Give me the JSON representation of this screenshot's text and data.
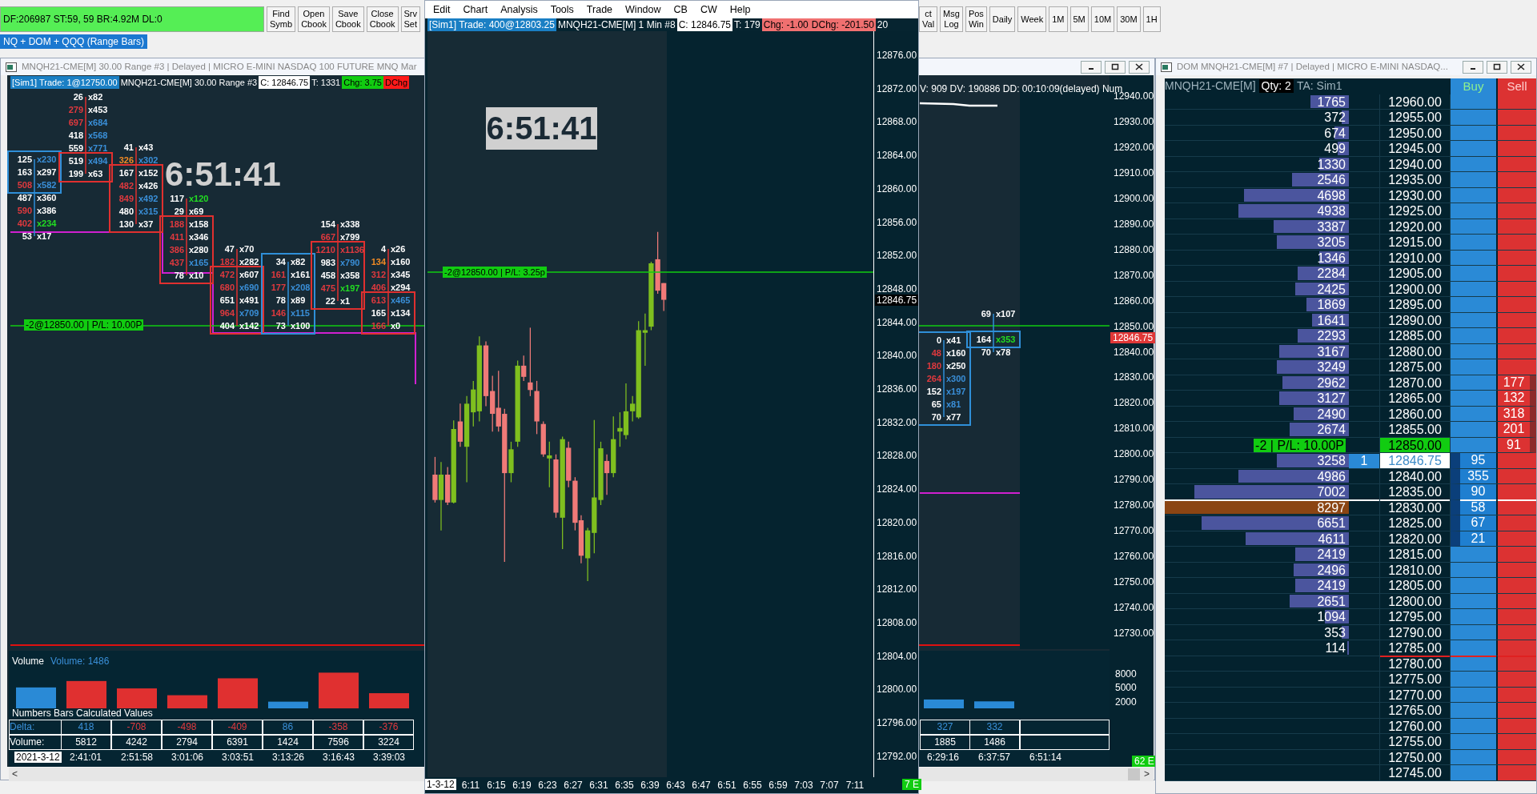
{
  "status_field": "DF:206987 ST:59, 59 BR:4.92M DL:0",
  "toolbar_left": [
    {
      "lines": [
        "Find",
        "Symb"
      ]
    },
    {
      "lines": [
        "Open",
        "Cbook"
      ]
    },
    {
      "lines": [
        "Save",
        "Cbook"
      ]
    },
    {
      "lines": [
        "Close",
        "Cbook"
      ]
    },
    {
      "lines": [
        "Srv",
        "Set"
      ]
    }
  ],
  "toolbar_right": [
    {
      "lines": [
        "ct",
        "Val"
      ]
    },
    {
      "lines": [
        "Msg",
        "Log"
      ]
    },
    {
      "lines": [
        "Pos",
        "Win"
      ]
    },
    {
      "lines": [
        "Daily"
      ]
    },
    {
      "lines": [
        "Week"
      ]
    },
    {
      "lines": [
        "1M"
      ]
    },
    {
      "lines": [
        "5M"
      ]
    },
    {
      "lines": [
        "10M"
      ]
    },
    {
      "lines": [
        "30M"
      ]
    },
    {
      "lines": [
        "1H"
      ]
    }
  ],
  "chartbook_tab": "NQ + DOM + QQQ (Range Bars)",
  "range_chart": {
    "title": "MNQH21-CME[M] 30.00 Range #3 | Delayed | MICRO E-MINI NASDAQ 100 FUTURE MNQ Mar",
    "header": [
      {
        "text": "[Sim1] Trade: 1@12750.00",
        "kind": "account"
      },
      {
        "text": "MNQH21-CME[M] 30.00 Range #3",
        "kind": "plain"
      },
      {
        "text": "C: 12846.75",
        "kind": "close"
      },
      {
        "text": "T: 1331",
        "kind": "plain"
      },
      {
        "text": "Chg: 3.75",
        "kind": "up"
      },
      {
        "text": "DChg",
        "kind": "loss"
      }
    ],
    "header_right": "V: 909 DV: 190886 DD: 00:10:09(delayed) Num",
    "clock": "6:51:41",
    "position_label": "-2@12850.00 | P/L: 10.00P",
    "footprint_bars": [
      {
        "color": "#2f8fd8",
        "box": [
          {
            "bid": {
              "text": "125",
              "color": "#ffffff"
            },
            "ask": {
              "text": "x230",
              "color": "#3a8fd8"
            }
          },
          {
            "bid": {
              "text": "163",
              "color": "#ffffff"
            },
            "ask": {
              "text": "x297",
              "color": "#ffffff"
            }
          },
          {
            "bid": {
              "text": "508",
              "color": "#e0393e"
            },
            "ask": {
              "text": "x582",
              "color": "#3a8fd8"
            }
          }
        ],
        "below": [
          {
            "bid": {
              "text": "487",
              "color": "#ffffff"
            },
            "ask": {
              "text": "x360",
              "color": "#ffffff"
            }
          },
          {
            "bid": {
              "text": "590",
              "color": "#e0393e"
            },
            "ask": {
              "text": "x386",
              "color": "#ffffff"
            }
          },
          {
            "bid": {
              "text": "402",
              "color": "#e0393e"
            },
            "ask": {
              "text": "x234",
              "color": "#22dd22"
            }
          },
          {
            "bid": {
              "text": "53",
              "color": "#ffffff"
            },
            "ask": {
              "text": "x17",
              "color": "#ffffff"
            }
          }
        ]
      },
      {
        "color": "#e0302f",
        "above": [
          {
            "bid": {
              "text": "26",
              "color": "#ffffff"
            },
            "ask": {
              "text": "x82",
              "color": "#ffffff"
            }
          },
          {
            "bid": {
              "text": "279",
              "color": "#e0393e"
            },
            "ask": {
              "text": "x453",
              "color": "#ffffff"
            }
          },
          {
            "bid": {
              "text": "697",
              "color": "#e0393e"
            },
            "ask": {
              "text": "x684",
              "color": "#3a8fd8"
            }
          },
          {
            "bid": {
              "text": "418",
              "color": "#ffffff"
            },
            "ask": {
              "text": "x568",
              "color": "#3a8fd8"
            }
          },
          {
            "bid": {
              "text": "559",
              "color": "#ffffff"
            },
            "ask": {
              "text": "x771",
              "color": "#3a8fd8"
            }
          }
        ],
        "box": [
          {
            "bid": {
              "text": "519",
              "color": "#ffffff"
            },
            "ask": {
              "text": "x494",
              "color": "#3a8fd8"
            }
          },
          {
            "bid": {
              "text": "199",
              "color": "#ffffff"
            },
            "ask": {
              "text": "x63",
              "color": "#ffffff"
            }
          }
        ]
      },
      {
        "color": "#e0302f",
        "above": [
          {
            "bid": {
              "text": "41",
              "color": "#ffffff"
            },
            "ask": {
              "text": "x43",
              "color": "#ffffff"
            }
          },
          {
            "bid": {
              "text": "326",
              "color": "#f08a24"
            },
            "ask": {
              "text": "x302",
              "color": "#3a8fd8"
            }
          }
        ],
        "box": [
          {
            "bid": {
              "text": "167",
              "color": "#ffffff"
            },
            "ask": {
              "text": "x152",
              "color": "#ffffff"
            }
          },
          {
            "bid": {
              "text": "482",
              "color": "#e0393e"
            },
            "ask": {
              "text": "x426",
              "color": "#ffffff"
            }
          },
          {
            "bid": {
              "text": "849",
              "color": "#e0393e"
            },
            "ask": {
              "text": "x492",
              "color": "#3a8fd8"
            }
          },
          {
            "bid": {
              "text": "480",
              "color": "#ffffff"
            },
            "ask": {
              "text": "x315",
              "color": "#3a8fd8"
            }
          },
          {
            "bid": {
              "text": "130",
              "color": "#ffffff"
            },
            "ask": {
              "text": "x37",
              "color": "#ffffff"
            }
          }
        ]
      },
      {
        "color": "#e0302f",
        "above": [
          {
            "bid": {
              "text": "117",
              "color": "#ffffff"
            },
            "ask": {
              "text": "x120",
              "color": "#22dd22"
            }
          },
          {
            "bid": {
              "text": "29",
              "color": "#ffffff"
            },
            "ask": {
              "text": "x69",
              "color": "#ffffff"
            }
          }
        ],
        "box": [
          {
            "bid": {
              "text": "188",
              "color": "#e0393e"
            },
            "ask": {
              "text": "x158",
              "color": "#ffffff"
            }
          },
          {
            "bid": {
              "text": "411",
              "color": "#e0393e"
            },
            "ask": {
              "text": "x346",
              "color": "#ffffff"
            }
          },
          {
            "bid": {
              "text": "386",
              "color": "#e0393e"
            },
            "ask": {
              "text": "x280",
              "color": "#ffffff"
            }
          },
          {
            "bid": {
              "text": "437",
              "color": "#e0393e"
            },
            "ask": {
              "text": "x165",
              "color": "#3a8fd8"
            }
          },
          {
            "bid": {
              "text": "78",
              "color": "#ffffff"
            },
            "ask": {
              "text": "x10",
              "color": "#ffffff"
            }
          }
        ]
      },
      {
        "color": "#e0302f",
        "above": [
          {
            "bid": {
              "text": "47",
              "color": "#ffffff"
            },
            "ask": {
              "text": "x70",
              "color": "#ffffff"
            }
          },
          {
            "bid": {
              "text": "182",
              "color": "#e0393e"
            },
            "ask": {
              "text": "x282",
              "color": "#ffffff"
            }
          }
        ],
        "box": [
          {
            "bid": {
              "text": "472",
              "color": "#e0393e"
            },
            "ask": {
              "text": "x607",
              "color": "#ffffff"
            }
          },
          {
            "bid": {
              "text": "680",
              "color": "#e0393e"
            },
            "ask": {
              "text": "x690",
              "color": "#3a8fd8"
            }
          },
          {
            "bid": {
              "text": "651",
              "color": "#ffffff"
            },
            "ask": {
              "text": "x491",
              "color": "#ffffff"
            }
          },
          {
            "bid": {
              "text": "964",
              "color": "#e0393e"
            },
            "ask": {
              "text": "x709",
              "color": "#3a8fd8"
            }
          },
          {
            "bid": {
              "text": "404",
              "color": "#ffffff"
            },
            "ask": {
              "text": "x142",
              "color": "#ffffff"
            }
          }
        ]
      },
      {
        "color": "#2f8fd8",
        "box": [
          {
            "bid": {
              "text": "34",
              "color": "#ffffff"
            },
            "ask": {
              "text": "x82",
              "color": "#ffffff"
            }
          },
          {
            "bid": {
              "text": "161",
              "color": "#e0393e"
            },
            "ask": {
              "text": "x161",
              "color": "#ffffff"
            }
          },
          {
            "bid": {
              "text": "177",
              "color": "#e0393e"
            },
            "ask": {
              "text": "x208",
              "color": "#3a8fd8"
            }
          },
          {
            "bid": {
              "text": "78",
              "color": "#ffffff"
            },
            "ask": {
              "text": "x89",
              "color": "#ffffff"
            }
          },
          {
            "bid": {
              "text": "146",
              "color": "#e0393e"
            },
            "ask": {
              "text": "x115",
              "color": "#3a8fd8"
            }
          },
          {
            "bid": {
              "text": "73",
              "color": "#ffffff"
            },
            "ask": {
              "text": "x100",
              "color": "#ffffff"
            }
          }
        ]
      },
      {
        "color": "#e0302f",
        "above": [
          {
            "bid": {
              "text": "154",
              "color": "#ffffff"
            },
            "ask": {
              "text": "x338",
              "color": "#ffffff"
            }
          },
          {
            "bid": {
              "text": "667",
              "color": "#e0393e"
            },
            "ask": {
              "text": "x799",
              "color": "#ffffff"
            }
          }
        ],
        "box": [
          {
            "bid": {
              "text": "1210",
              "color": "#e0393e"
            },
            "ask": {
              "text": "x1136",
              "color": "#e0393e"
            }
          },
          {
            "bid": {
              "text": "983",
              "color": "#ffffff"
            },
            "ask": {
              "text": "x790",
              "color": "#3a8fd8"
            }
          },
          {
            "bid": {
              "text": "458",
              "color": "#ffffff"
            },
            "ask": {
              "text": "x358",
              "color": "#ffffff"
            }
          },
          {
            "bid": {
              "text": "475",
              "color": "#e0393e"
            },
            "ask": {
              "text": "x197",
              "color": "#22dd22"
            }
          },
          {
            "bid": {
              "text": "22",
              "color": "#ffffff"
            },
            "ask": {
              "text": "x1",
              "color": "#ffffff"
            }
          }
        ]
      },
      {
        "color": "#e0302f",
        "above": [
          {
            "bid": {
              "text": "4",
              "color": "#ffffff"
            },
            "ask": {
              "text": "x26",
              "color": "#ffffff"
            }
          },
          {
            "bid": {
              "text": "134",
              "color": "#f08a24"
            },
            "ask": {
              "text": "x160",
              "color": "#ffffff"
            }
          },
          {
            "bid": {
              "text": "312",
              "color": "#e0393e"
            },
            "ask": {
              "text": "x345",
              "color": "#ffffff"
            }
          },
          {
            "bid": {
              "text": "406",
              "color": "#e0393e"
            },
            "ask": {
              "text": "x294",
              "color": "#ffffff"
            }
          }
        ],
        "box": [
          {
            "bid": {
              "text": "613",
              "color": "#e0393e"
            },
            "ask": {
              "text": "x465",
              "color": "#3a8fd8"
            }
          },
          {
            "bid": {
              "text": "165",
              "color": "#ffffff"
            },
            "ask": {
              "text": "x134",
              "color": "#ffffff"
            }
          },
          {
            "bid": {
              "text": "166",
              "color": "#e0393e"
            },
            "ask": {
              "text": "x0",
              "color": "#ffffff"
            }
          }
        ]
      },
      {
        "color": "#2f8fd8",
        "box": [
          {
            "bid": {
              "text": "0",
              "color": "#ffffff"
            },
            "ask": {
              "text": "x41",
              "color": "#ffffff"
            }
          },
          {
            "bid": {
              "text": "48",
              "color": "#e0393e"
            },
            "ask": {
              "text": "x160",
              "color": "#ffffff"
            }
          },
          {
            "bid": {
              "text": "180",
              "color": "#e0393e"
            },
            "ask": {
              "text": "x250",
              "color": "#ffffff"
            }
          },
          {
            "bid": {
              "text": "264",
              "color": "#e0393e"
            },
            "ask": {
              "text": "x300",
              "color": "#3a8fd8"
            }
          },
          {
            "bid": {
              "text": "152",
              "color": "#ffffff"
            },
            "ask": {
              "text": "x197",
              "color": "#3a8fd8"
            }
          },
          {
            "bid": {
              "text": "65",
              "color": "#ffffff"
            },
            "ask": {
              "text": "x81",
              "color": "#3a8fd8"
            }
          },
          {
            "bid": {
              "text": "70",
              "color": "#ffffff"
            },
            "ask": {
              "text": "x77",
              "color": "#ffffff"
            }
          }
        ]
      },
      {
        "color": "#2f8fd8",
        "above": [
          {
            "bid": {
              "text": "69",
              "color": "#ffffff"
            },
            "ask": {
              "text": "x107",
              "color": "#ffffff"
            }
          }
        ],
        "box": [
          {
            "bid": {
              "text": "164",
              "color": "#ffffff"
            },
            "ask": {
              "text": "x353",
              "color": "#22dd22"
            }
          }
        ],
        "below": [
          {
            "bid": {
              "text": "70",
              "color": "#ffffff"
            },
            "ask": {
              "text": "x78",
              "color": "#ffffff"
            }
          }
        ]
      }
    ],
    "price_axis": [
      "12940.00",
      "12930.00",
      "12920.00",
      "12910.00",
      "12900.00",
      "12890.00",
      "12880.00",
      "12870.00",
      "12860.00",
      "12850.00",
      "12840.00",
      "12830.00",
      "12820.00",
      "12810.00",
      "12800.00",
      "12790.00",
      "12780.00",
      "12770.00",
      "12760.00",
      "12750.00",
      "12740.00",
      "12730.00"
    ],
    "last_price": "12846.75",
    "volume_title": "Volume",
    "volume_reading": "Volume: 1486",
    "volume_axis": [
      "8000",
      "5000",
      "2000"
    ],
    "study_title": "Numbers Bars Calculated Values",
    "table": [
      {
        "label": {
          "text": "Delta:",
          "color": "#3a8fd8"
        },
        "cells": [
          {
            "text": "418",
            "color": "#3a8fd8"
          },
          {
            "text": "-708",
            "color": "#e0393e"
          },
          {
            "text": "-498",
            "color": "#e0393e"
          },
          {
            "text": "-409",
            "color": "#e0393e"
          },
          {
            "text": "86",
            "color": "#3a8fd8"
          },
          {
            "text": "-358",
            "color": "#e0393e"
          },
          {
            "text": "-376",
            "color": "#e0393e"
          },
          {
            "text": "327",
            "color": "#3a8fd8"
          },
          {
            "text": "332",
            "color": "#3a8fd8"
          }
        ]
      },
      {
        "label": {
          "text": "Volume:",
          "color": "#ffffff"
        },
        "cells": [
          "5812",
          "4242",
          "2794",
          "6391",
          "1424",
          "7596",
          "3224",
          "1885",
          "1486"
        ]
      }
    ],
    "date": "2021-3-12",
    "time_axis": [
      "2:41:01",
      "2:51:58",
      "3:01:06",
      "3:03:51",
      "3:13:26",
      "3:16:43",
      "3:39:03",
      "6:29:16",
      "6:37:57",
      "6:51:14"
    ],
    "status_badge": "62 E",
    "scroll_left": "<",
    "scroll_right": ">"
  },
  "minute_chart": {
    "menu": [
      "Edit",
      "Chart",
      "Analysis",
      "Tools",
      "Trade",
      "Window",
      "CB",
      "CW",
      "Help"
    ],
    "header": [
      {
        "text": "[Sim1] Trade: 400@12803.25",
        "kind": "account"
      },
      {
        "text": "MNQH21-CME[M] 1 Min #8",
        "kind": "plain"
      },
      {
        "text": "C: 12846.75",
        "kind": "close"
      },
      {
        "text": "T: 179",
        "kind": "plain"
      },
      {
        "text": "Chg: -1.00",
        "kind": "down"
      },
      {
        "text": "DChg: -201.50",
        "kind": "down"
      },
      {
        "text": "20",
        "kind": "plain"
      }
    ],
    "clock": "6:51:41",
    "position_label": "-2@12850.00 | P/L: 3.25p",
    "price_axis": [
      "12876.00",
      "12872.00",
      "12868.00",
      "12864.00",
      "12860.00",
      "12856.00",
      "12852.00",
      "12848.00",
      "12844.00",
      "12840.00",
      "12836.00",
      "12832.00",
      "12828.00",
      "12824.00",
      "12820.00",
      "12816.00",
      "12812.00",
      "12808.00",
      "12804.00",
      "12800.00",
      "12796.00",
      "12792.00"
    ],
    "last_price": "12846.75",
    "date": "1-3-12",
    "time_axis": [
      "6:11",
      "6:15",
      "6:19",
      "6:23",
      "6:27",
      "6:31",
      "6:35",
      "6:39",
      "6:43",
      "6:47",
      "6:51",
      "6:55",
      "6:59",
      "7:03",
      "7:07",
      "7:11"
    ],
    "status_badge": "7 E"
  },
  "dom": {
    "title": "DOM MNQH21-CME[M] #7 | Delayed | MICRO E-MINI NASDAQ...",
    "symbol": "MNQH21-CME[M]",
    "quantity": "Qty: 2",
    "account": "TA: Sim1",
    "buy_header": "Buy",
    "sell_header": "Sell",
    "rows": [
      {
        "price": "12960.00",
        "kind": "normal",
        "volume": "1765",
        "level": 0.21
      },
      {
        "price": "12955.00",
        "kind": "normal",
        "volume": "372",
        "level": 0.04
      },
      {
        "price": "12950.00",
        "kind": "normal",
        "volume": "674",
        "level": 0.08
      },
      {
        "price": "12945.00",
        "kind": "normal",
        "volume": "499",
        "level": 0.06
      },
      {
        "price": "12940.00",
        "kind": "normal",
        "volume": "1330",
        "level": 0.16
      },
      {
        "price": "12935.00",
        "kind": "normal",
        "volume": "2546",
        "level": 0.31
      },
      {
        "price": "12930.00",
        "kind": "normal",
        "volume": "4698",
        "level": 0.57
      },
      {
        "price": "12925.00",
        "kind": "normal",
        "volume": "4938",
        "level": 0.6
      },
      {
        "price": "12920.00",
        "kind": "normal",
        "volume": "3387",
        "level": 0.41
      },
      {
        "price": "12915.00",
        "kind": "normal",
        "volume": "3205",
        "level": 0.39
      },
      {
        "price": "12910.00",
        "kind": "normal",
        "volume": "1346",
        "level": 0.16
      },
      {
        "price": "12905.00",
        "kind": "normal",
        "volume": "2284",
        "level": 0.28
      },
      {
        "price": "12900.00",
        "kind": "normal",
        "volume": "2425",
        "level": 0.29
      },
      {
        "price": "12895.00",
        "kind": "normal",
        "volume": "1869",
        "level": 0.23
      },
      {
        "price": "12890.00",
        "kind": "normal",
        "volume": "1641",
        "level": 0.2
      },
      {
        "price": "12885.00",
        "kind": "normal",
        "volume": "2293",
        "level": 0.28
      },
      {
        "price": "12880.00",
        "kind": "normal",
        "volume": "3167",
        "level": 0.38
      },
      {
        "price": "12875.00",
        "kind": "normal",
        "volume": "3249",
        "level": 0.39
      },
      {
        "price": "12870.00",
        "kind": "normal",
        "volume": "2962",
        "level": 0.36,
        "sell": "177"
      },
      {
        "price": "12865.00",
        "kind": "normal",
        "volume": "3127",
        "level": 0.38,
        "sell": "132"
      },
      {
        "price": "12860.00",
        "kind": "normal",
        "volume": "2490",
        "level": 0.3,
        "sell": "318"
      },
      {
        "price": "12855.00",
        "kind": "normal",
        "volume": "2674",
        "level": 0.32,
        "sell": "201"
      },
      {
        "price": "12850.00",
        "kind": "position",
        "position_label": "-2 | P/L: 10.00P",
        "sell": "91"
      },
      {
        "price": "12846.75",
        "kind": "last",
        "volume": "3258",
        "level": 0.39,
        "bid": "1",
        "buy": "95"
      },
      {
        "price": "12840.00",
        "kind": "normal",
        "volume": "4986",
        "level": 0.6,
        "buy": "355"
      },
      {
        "price": "12835.00",
        "kind": "normal",
        "volume": "7002",
        "level": 0.84,
        "buy": "90",
        "separator": {
          "color": "#ffffff"
        }
      },
      {
        "price": "12830.00",
        "kind": "max",
        "volume": "8297",
        "level": 1,
        "buy": "58"
      },
      {
        "price": "12825.00",
        "kind": "normal",
        "volume": "6651",
        "level": 0.8,
        "buy": "67"
      },
      {
        "price": "12820.00",
        "kind": "normal",
        "volume": "4611",
        "level": 0.56,
        "buy": "21"
      },
      {
        "price": "12815.00",
        "kind": "normal",
        "volume": "2419",
        "level": 0.29
      },
      {
        "price": "12810.00",
        "kind": "normal",
        "volume": "2496",
        "level": 0.3
      },
      {
        "price": "12805.00",
        "kind": "normal",
        "volume": "2419",
        "level": 0.29
      },
      {
        "price": "12800.00",
        "kind": "normal",
        "volume": "2651",
        "level": 0.32
      },
      {
        "price": "12795.00",
        "kind": "normal",
        "volume": "1094",
        "level": 0.13
      },
      {
        "price": "12790.00",
        "kind": "normal",
        "volume": "353",
        "level": 0.04
      },
      {
        "price": "12785.00",
        "kind": "normal",
        "volume": "114",
        "level": 0.01,
        "separator": {
          "color": "#e02020"
        }
      },
      {
        "price": "12780.00",
        "kind": "normal"
      },
      {
        "price": "12775.00",
        "kind": "normal"
      },
      {
        "price": "12770.00",
        "kind": "normal"
      },
      {
        "price": "12765.00",
        "kind": "normal"
      },
      {
        "price": "12760.00",
        "kind": "normal"
      },
      {
        "price": "12755.00",
        "kind": "normal"
      },
      {
        "price": "12750.00",
        "kind": "normal"
      },
      {
        "price": "12745.00",
        "kind": "normal"
      }
    ]
  }
}
